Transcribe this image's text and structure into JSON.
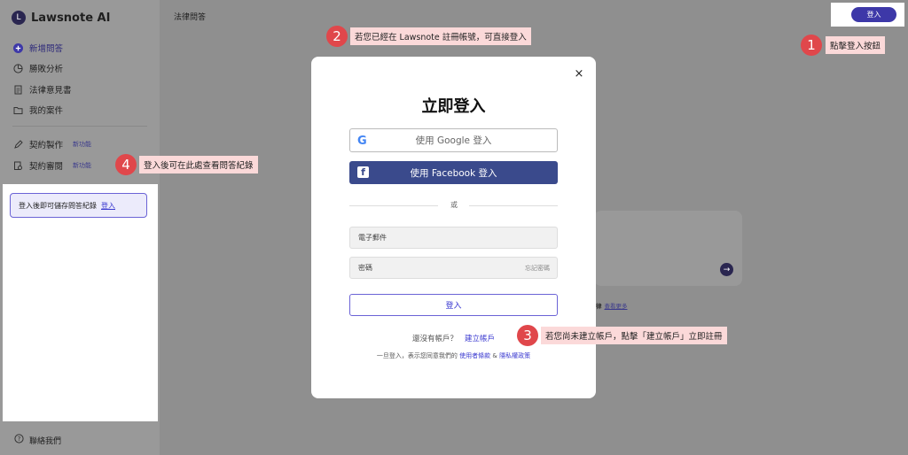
{
  "sidebar": {
    "logo": "Lawsnote AI",
    "items": [
      {
        "label": "新增問答",
        "icon": "plus-circle-icon"
      },
      {
        "label": "勝敗分析",
        "icon": "pie-chart-icon"
      },
      {
        "label": "法律意見書",
        "icon": "document-icon"
      },
      {
        "label": "我的案件",
        "icon": "folder-icon"
      },
      {
        "label": "契約製作",
        "icon": "pen-icon",
        "badge": "新功能"
      },
      {
        "label": "契約審閱",
        "icon": "review-icon",
        "badge": "新功能"
      }
    ],
    "history_prompt": "登入後即可儲存問答紀錄",
    "history_login": "登入",
    "contact": "聯絡我們"
  },
  "header": {
    "title": "法律問答",
    "login": "登入"
  },
  "background": {
    "more": "查看更多",
    "prefix": "律"
  },
  "modal": {
    "close": "×",
    "title": "立即登入",
    "google": "使用 Google 登入",
    "facebook": "使用 Facebook 登入",
    "or": "或",
    "email_placeholder": "電子郵件",
    "password_placeholder": "密碼",
    "forgot": "忘記密碼",
    "submit": "登入",
    "no_account": "還沒有帳戶？",
    "create_account": "建立帳戶",
    "terms_prefix": "一旦登入，表示您同意我們的",
    "terms_link": "使用者條款",
    "terms_and": "&",
    "privacy_link": "隱私權政策"
  },
  "annotations": [
    {
      "num": "1",
      "text": "點擊登入按鈕"
    },
    {
      "num": "2",
      "text": "若您已經在 Lawsnote 註冊帳號，可直接登入"
    },
    {
      "num": "3",
      "text": "若您尚未建立帳戶，點擊「建立帳戶」立即註冊"
    },
    {
      "num": "4",
      "text": "登入後可在此處查看問答紀錄"
    }
  ],
  "colors": {
    "accent": "#3d38a8",
    "annotation": "#e0474b",
    "facebook": "#3a4a8c"
  }
}
